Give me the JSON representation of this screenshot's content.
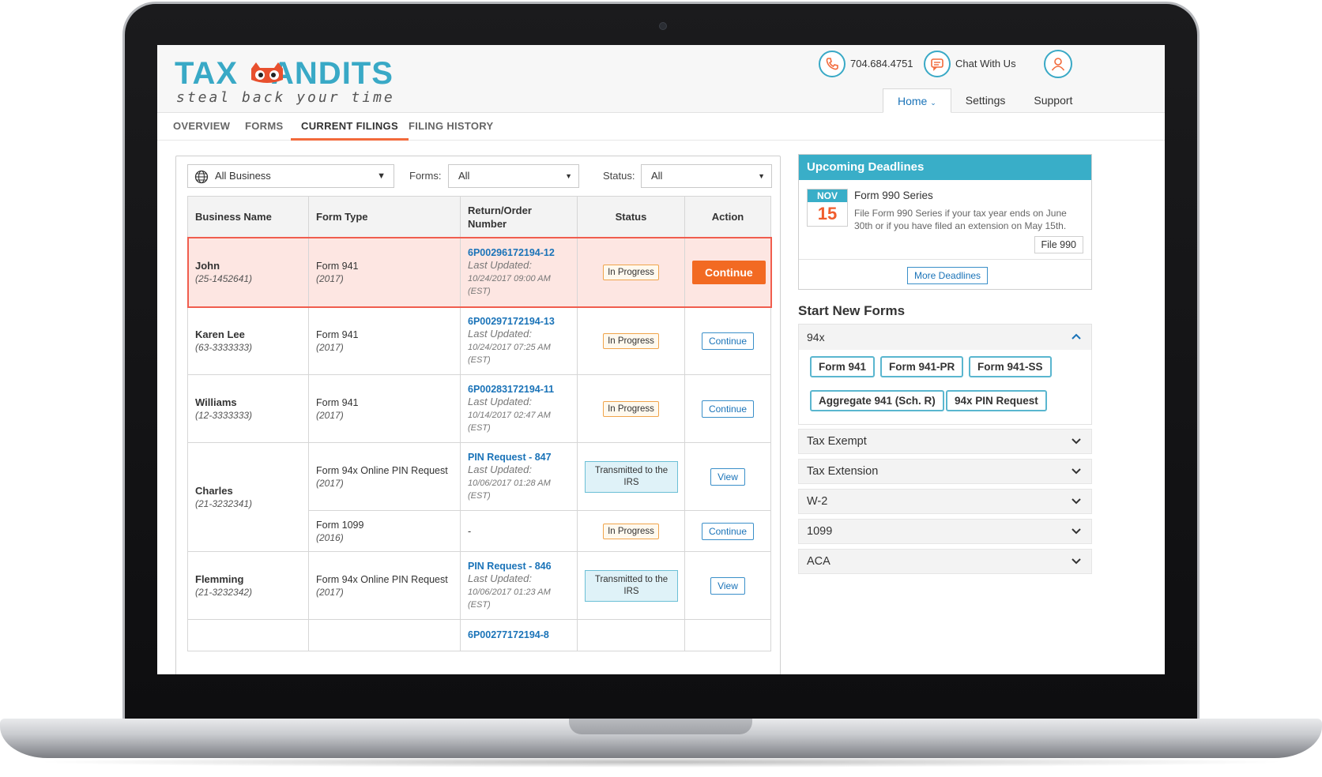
{
  "header": {
    "logo_word_left": "TAX",
    "logo_word_right": "ANDITS",
    "tagline": "steal back your time",
    "phone": "704.684.4751",
    "chat": "Chat With Us",
    "nav": [
      "Home",
      "Settings",
      "Support"
    ]
  },
  "tabs": [
    "OVERVIEW",
    "FORMS",
    "CURRENT FILINGS",
    "FILING HISTORY"
  ],
  "filters": {
    "business": "All Business",
    "forms_label": "Forms:",
    "forms_value": "All",
    "status_label": "Status:",
    "status_value": "All"
  },
  "table": {
    "headers": [
      "Business Name",
      "Form Type",
      "Return/Order Number",
      "Status",
      "Action"
    ],
    "rows": [
      {
        "name": "John",
        "ein": "(25-1452641)",
        "form": "Form 941",
        "year": "(2017)",
        "ret": "6P00296172194-12",
        "lu": "Last Updated:",
        "date": "10/24/2017 09:00 AM",
        "tz": "(EST)",
        "status": "In Progress",
        "action": "Continue"
      },
      {
        "name": "Karen Lee",
        "ein": "(63-3333333)",
        "form": "Form 941",
        "year": "(2017)",
        "ret": "6P00297172194-13",
        "lu": "Last Updated:",
        "date": "10/24/2017 07:25 AM",
        "tz": "(EST)",
        "status": "In Progress",
        "action": "Continue"
      },
      {
        "name": "Williams",
        "ein": "(12-3333333)",
        "form": "Form 941",
        "year": "(2017)",
        "ret": "6P00283172194-11",
        "lu": "Last Updated:",
        "date": "10/14/2017 02:47 AM",
        "tz": "(EST)",
        "status": "In Progress",
        "action": "Continue"
      },
      {
        "name": "Charles",
        "ein": "(21-3232341)",
        "form": "Form 94x Online PIN Request",
        "year": "(2017)",
        "ret": "PIN Request - 847",
        "lu": "Last Updated:",
        "date": "10/06/2017 01:28 AM",
        "tz": "(EST)",
        "status": "Transmitted to the IRS",
        "action": "View"
      },
      {
        "form": "Form 1099",
        "year": "(2016)",
        "ret": "-",
        "status": "In Progress",
        "action": "Continue"
      },
      {
        "name": "Flemming",
        "ein": "(21-3232342)",
        "form": "Form 94x Online PIN Request",
        "year": "(2017)",
        "ret": "PIN Request - 846",
        "lu": "Last Updated:",
        "date": "10/06/2017 01:23 AM",
        "tz": "(EST)",
        "status": "Transmitted to the IRS",
        "action": "View"
      },
      {
        "ret": "6P00277172194-8"
      }
    ]
  },
  "deadlines": {
    "title": "Upcoming Deadlines",
    "month": "NOV",
    "day": "15",
    "form": "Form 990 Series",
    "desc": "File Form 990 Series if your tax year ends on June 30th or if you have filed an extension on May 15th.",
    "button": "File 990",
    "more": "More Deadlines"
  },
  "start_new": {
    "title": "Start New Forms",
    "group_94x": "94x",
    "forms_94x": [
      "Form 941",
      "Form 941-PR",
      "Form 941-SS",
      "Aggregate 941 (Sch. R)",
      "94x PIN Request"
    ],
    "groups": [
      "Tax Exempt",
      "Tax Extension",
      "W-2",
      "1099",
      "ACA"
    ]
  },
  "colors": {
    "brand_teal": "#39a9c6",
    "accent_orange": "#f26a22",
    "link_blue": "#1a73b8",
    "highlight_row": "#fde6e2"
  }
}
